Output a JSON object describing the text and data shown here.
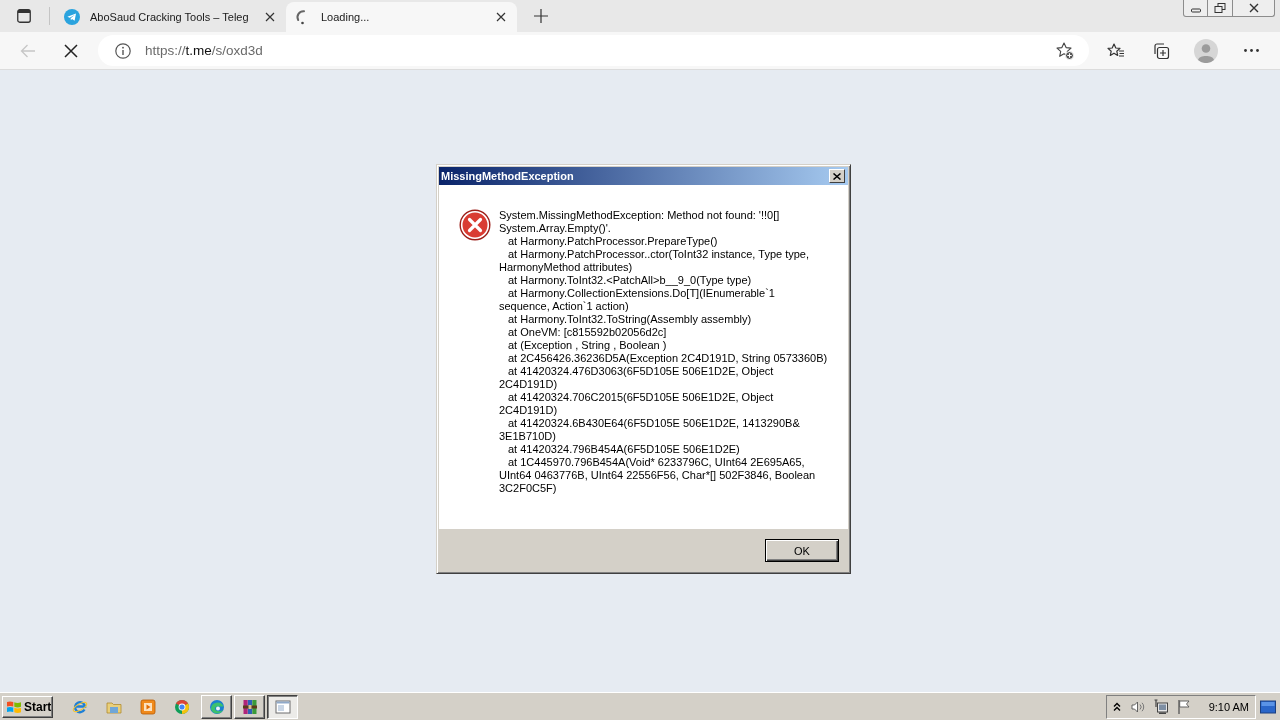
{
  "browser": {
    "tabs": [
      {
        "title": "AboSaud Cracking Tools – Teleg",
        "selected": false,
        "loading": false
      },
      {
        "title": "Loading...",
        "selected": true,
        "loading": true
      }
    ],
    "toolbar": {
      "back_disabled": true,
      "page_loading": true,
      "url": {
        "scheme": "https://",
        "host": "t.me",
        "path": "/s/oxd3d"
      }
    }
  },
  "dialog": {
    "title": "MissingMethodException",
    "message": {
      "lines": [
        "System.MissingMethodException: Method not found: '!!0[]",
        "System.Array.Empty()'."
      ]
    },
    "stack_frames": [
      {
        "lines": [
          "at Harmony.PatchProcessor.PrepareType()"
        ]
      },
      {
        "lines": [
          "at Harmony.PatchProcessor..ctor(ToInt32 instance, Type type,",
          "HarmonyMethod attributes)"
        ]
      },
      {
        "lines": [
          "at Harmony.ToInt32.<PatchAll>b__9_0(Type type)"
        ]
      },
      {
        "lines": [
          "at Harmony.CollectionExtensions.Do[T](IEnumerable`1",
          "sequence, Action`1 action)"
        ]
      },
      {
        "lines": [
          "at Harmony.ToInt32.ToString(Assembly assembly)"
        ]
      },
      {
        "lines": [
          "at OneVM: [c815592b02056d2c]"
        ]
      },
      {
        "lines": [
          "at (Exception , String , Boolean )"
        ]
      },
      {
        "lines": [
          "at 2C456426.36236D5A(Exception 2C4D191D, String 0573360B)"
        ]
      },
      {
        "lines": [
          "at 41420324.476D3063(6F5D105E 506E1D2E, Object",
          "2C4D191D)"
        ]
      },
      {
        "lines": [
          "at 41420324.706C2015(6F5D105E 506E1D2E, Object",
          "2C4D191D)"
        ]
      },
      {
        "lines": [
          "at 41420324.6B430E64(6F5D105E 506E1D2E, 1413290B&",
          "3E1B710D)"
        ]
      },
      {
        "lines": [
          "at 41420324.796B454A(6F5D105E 506E1D2E)"
        ]
      },
      {
        "lines": [
          "at 1C445970.796B454A(Void* 6233796C, UInt64 2E695A65,",
          "UInt64 0463776B, UInt64 22556F56, Char*[] 502F3846, Boolean",
          "3C2F0C5F)"
        ]
      }
    ],
    "button": "OK"
  },
  "taskbar": {
    "start": "Start",
    "window_buttons": [
      {
        "selected": false
      },
      {
        "selected": false
      },
      {
        "selected": true
      }
    ],
    "clock": "9:10 AM"
  }
}
